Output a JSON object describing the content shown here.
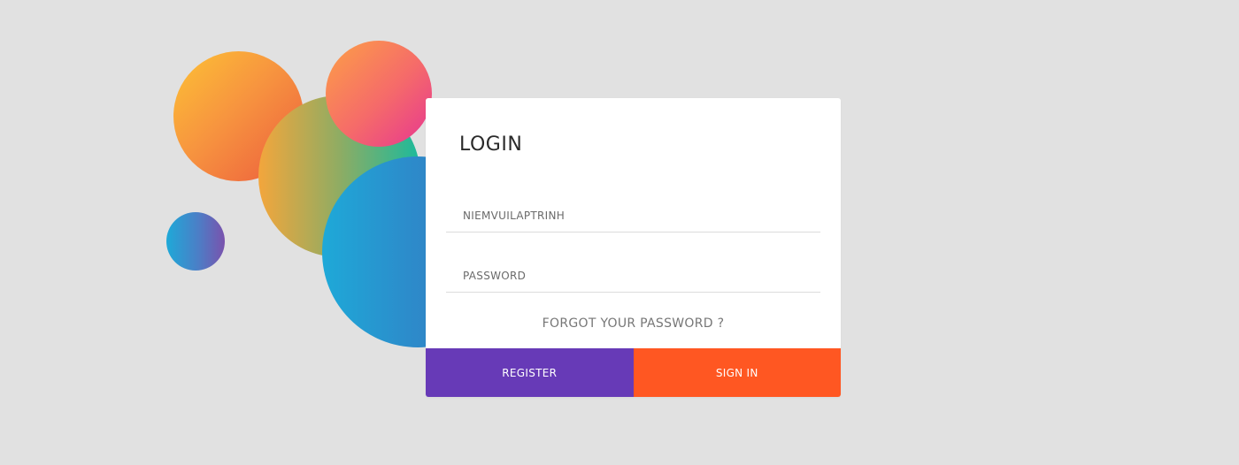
{
  "login_card": {
    "title": "LOGIN",
    "username_placeholder": "NIEMVUILAPTRINH",
    "password_placeholder": "PASSWORD",
    "forgot_password_label": "FORGOT YOUR PASSWORD ?",
    "register_label": "REGISTER",
    "signin_label": "SIGN IN"
  },
  "colors": {
    "background": "#e1e1e1",
    "card": "#ffffff",
    "register_button": "#673ab7",
    "signin_button": "#ff5722"
  },
  "decorations": [
    {
      "name": "orange-gradient-circle",
      "gradient": [
        "#fdc135",
        "#ec5b3e"
      ]
    },
    {
      "name": "green-gradient-circle",
      "gradient": [
        "#f3a63c",
        "#1bba9c"
      ]
    },
    {
      "name": "pink-gradient-circle",
      "gradient": [
        "#fda046",
        "#e63592"
      ]
    },
    {
      "name": "blue-gradient-circle-large",
      "gradient": [
        "#1ea9d8",
        "#3a6fb8"
      ]
    },
    {
      "name": "blue-gradient-circle-small",
      "gradient": [
        "#1ea9d8",
        "#7a52ad"
      ]
    }
  ]
}
